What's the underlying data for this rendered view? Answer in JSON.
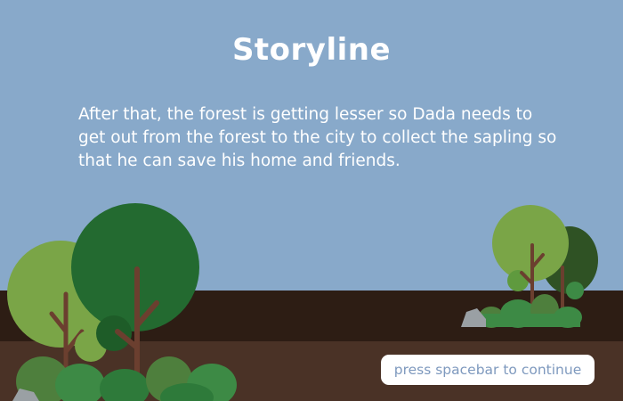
{
  "screen": {
    "title": "Storyline",
    "story_text": "After that, the forest is getting lesser so Dada needs to get out from the forest to the city to collect the sapling so that he can save his home and friends.",
    "continue_prompt": "press spacebar to continue"
  },
  "colors": {
    "sky": "#88a9ca",
    "ground_far": "#2d1d14",
    "ground_near": "#4a3226",
    "title_text": "#ffffff",
    "button_bg": "#ffffff",
    "button_text": "#7e99be",
    "tree_light": "#7aa547",
    "tree_dark": "#236a30",
    "tree_darker": "#2f5224",
    "trunk": "#6b3f2f",
    "bush": "#3d8a45",
    "rock": "#9aa0a4"
  }
}
